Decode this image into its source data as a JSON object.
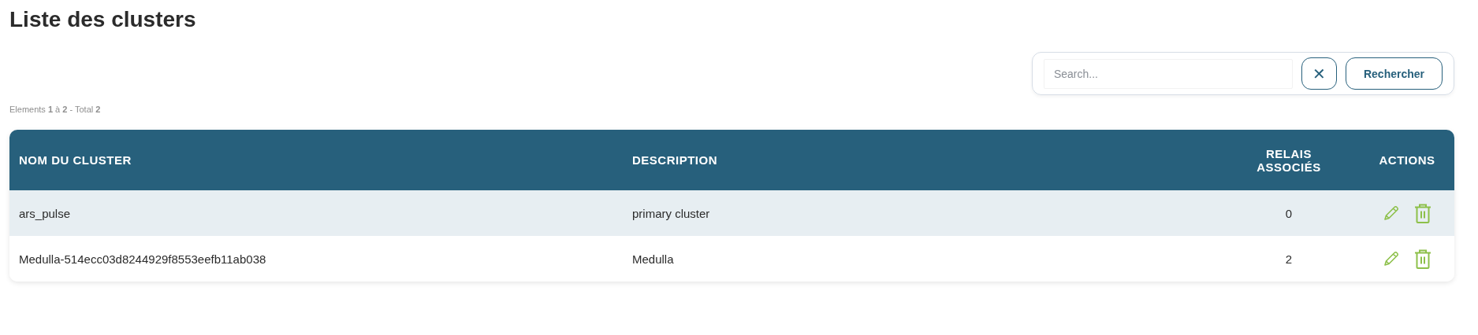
{
  "title": "Liste des clusters",
  "search": {
    "placeholder": "Search...",
    "clear_label": "✕",
    "button": "Rechercher"
  },
  "count": "Elements **1** à **2** - Total **2**",
  "table": {
    "columns": [
      "NOM DU CLUSTER",
      "DESCRIPTION",
      "RELAIS ASSOCIÉS",
      "ACTIONS"
    ],
    "rows": [
      {
        "name": "ars_pulse",
        "description": "primary cluster",
        "relays": "0"
      },
      {
        "name": "Medulla-514ecc03d8244929f8553eefb11ab038",
        "description": "Medulla",
        "relays": "2"
      }
    ]
  }
}
